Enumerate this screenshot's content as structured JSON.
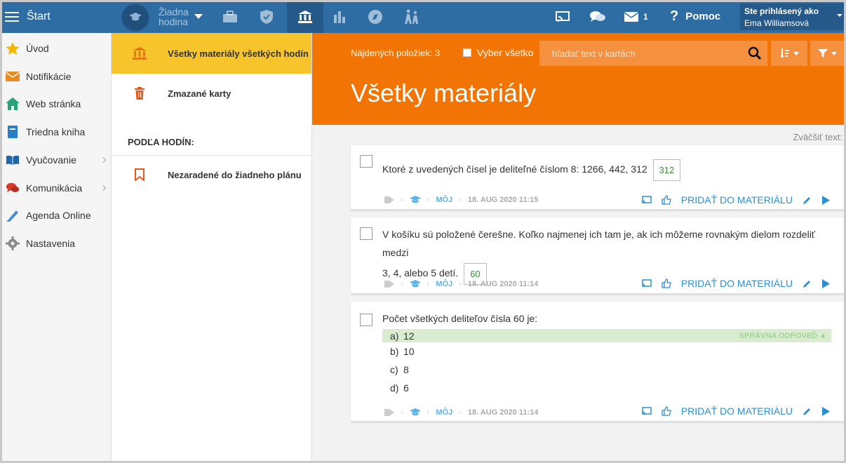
{
  "topbar": {
    "start_label": "Štart",
    "lesson_line1": "Žiadna",
    "lesson_line2": "hodina",
    "messages_count": "1",
    "help_label": "Pomoc",
    "user_label": "Ste prihlásený ako",
    "user_name": "Ema Williamsová"
  },
  "sidebar": {
    "items": [
      {
        "label": "Úvod",
        "icon": "star-icon"
      },
      {
        "label": "Notifikácie",
        "icon": "envelope-icon"
      },
      {
        "label": "Web stránka",
        "icon": "house-icon"
      },
      {
        "label": "Triedna kniha",
        "icon": "notebook-icon"
      },
      {
        "label": "Vyučovanie",
        "icon": "open-book-icon"
      },
      {
        "label": "Komunikácia",
        "icon": "chat-icon"
      },
      {
        "label": "Agenda Online",
        "icon": "pen-icon"
      },
      {
        "label": "Nastavenia",
        "icon": "gear-icon"
      }
    ]
  },
  "midpanel": {
    "all_materials": "Všetky materiály všetkých hodín",
    "deleted_cards": "Zmazané karty",
    "by_lesson_heading": "PODĽA HODÍN:",
    "unassigned": "Nezaradené do žiadneho plánu"
  },
  "main": {
    "found_label": "Nájdených položiek: 3",
    "select_all": "Vyber všetko",
    "search_placeholder": "hľadať text v kartách",
    "title": "Všetky materiály",
    "zoom_label": "Zväčšiť text:"
  },
  "cards": [
    {
      "question": "Ktoré z uvedených čísel je deliteľné číslom 8: 1266, 442, 312",
      "answer": "312",
      "owner": "MÔJ",
      "date": "18. AUG 2020 11:15",
      "add_label": "PRIDAŤ DO MATERIÁLU"
    },
    {
      "question_line1": "V košíku sú položené čerešne. Koľko najmenej ich tam je, ak ich môžeme rovnakým dielom rozdeliť medzi",
      "question_line2": "3, 4, alebo 5 detí.",
      "answer": "60",
      "owner": "MÔJ",
      "date": "18. AUG 2020 11:14",
      "add_label": "PRIDAŤ DO MATERIÁLU"
    },
    {
      "question": "Počet všetkých deliteľov čísla 60 je:",
      "options": [
        {
          "letter": "a)",
          "value": "12"
        },
        {
          "letter": "b)",
          "value": "10"
        },
        {
          "letter": "c)",
          "value": "8"
        },
        {
          "letter": "d)",
          "value": "6"
        }
      ],
      "correct_label": "SPRÁVNA ODPOVEĎ",
      "owner": "MÔJ",
      "date": "18. AUG 2020 11:14",
      "add_label": "PRIDAŤ DO MATERIÁLU"
    }
  ],
  "colors": {
    "topbar": "#2e6da4",
    "accent_orange": "#f27405",
    "active_yellow": "#f7c52b",
    "link_blue": "#2b8fd6",
    "correct_green": "#d9ecd0"
  }
}
